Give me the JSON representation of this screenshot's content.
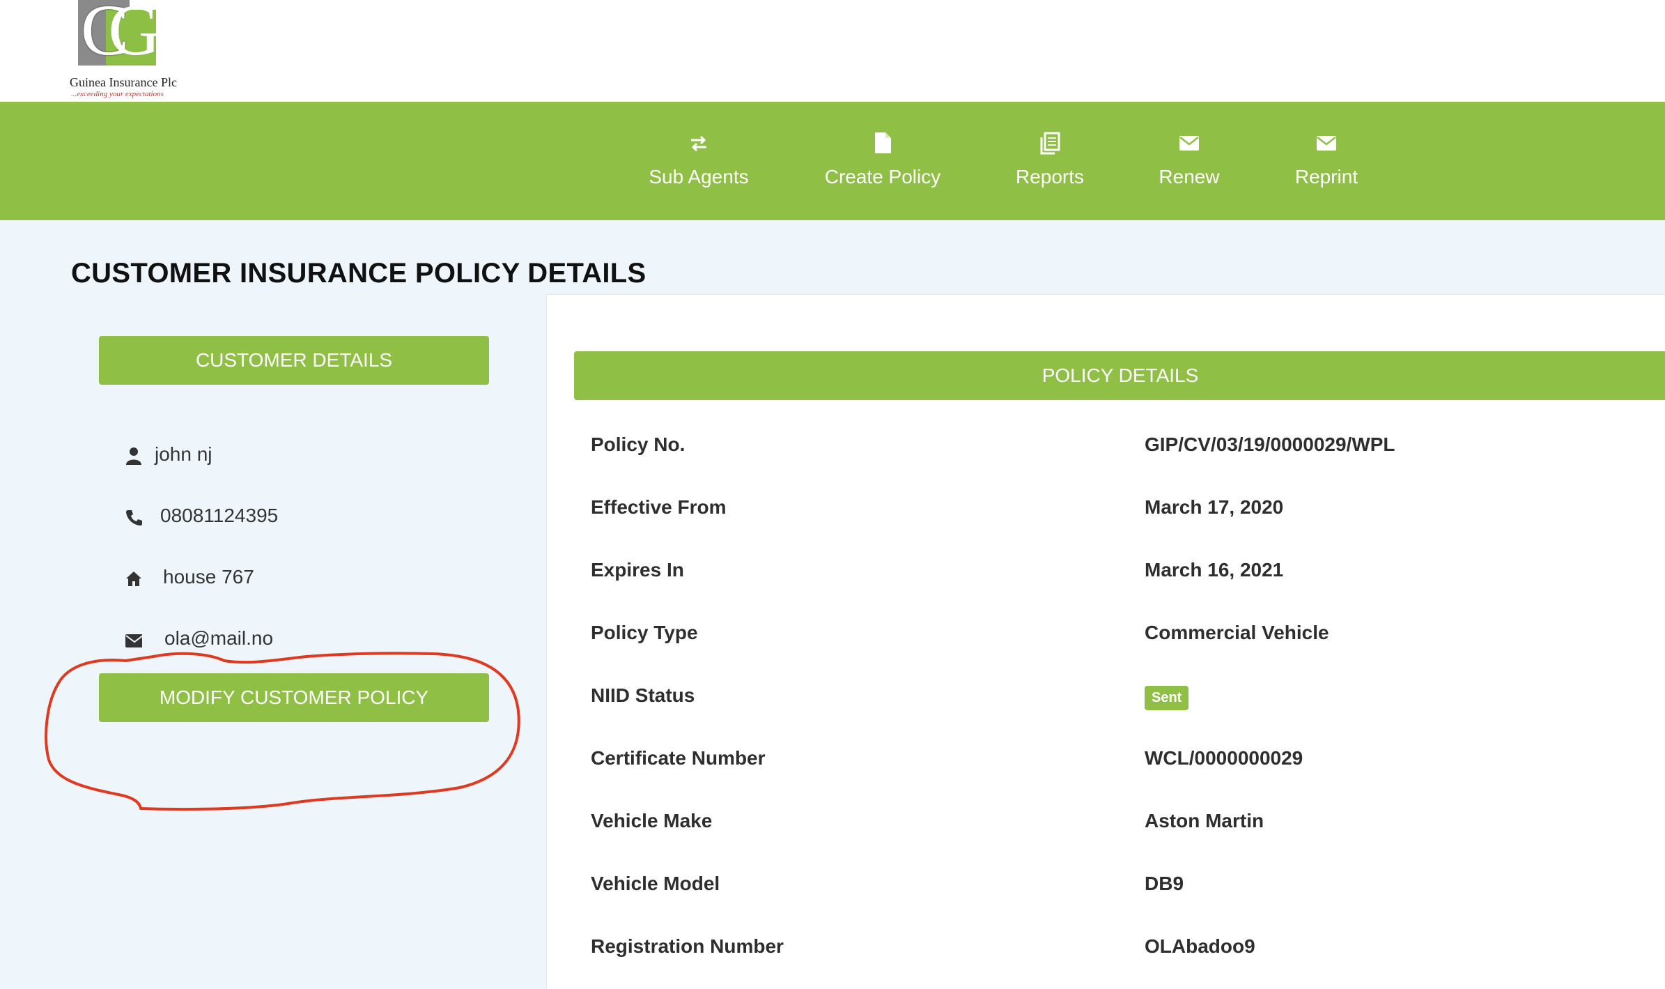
{
  "brand": {
    "name": "Guinea Insurance Plc",
    "tagline": "...exceeding your expectations",
    "logo_letters": "G"
  },
  "nav": [
    {
      "label": "Sub Agents",
      "icon": "swap-arrows-icon"
    },
    {
      "label": "Create Policy",
      "icon": "document-icon"
    },
    {
      "label": "Reports",
      "icon": "reports-icon"
    },
    {
      "label": "Renew",
      "icon": "envelope-icon"
    },
    {
      "label": "Reprint",
      "icon": "envelope-icon"
    }
  ],
  "page_title": "CUSTOMER INSURANCE POLICY DETAILS",
  "customer": {
    "header": "CUSTOMER DETAILS",
    "name": "john nj",
    "phone": "08081124395",
    "address": "house 767",
    "email": "ola@mail.no",
    "modify_button": "MODIFY CUSTOMER POLICY"
  },
  "policy": {
    "header": "POLICY DETAILS",
    "rows": [
      {
        "label": "Policy No.",
        "value": "GIP/CV/03/19/0000029/WPL"
      },
      {
        "label": "Effective From",
        "value": "March 17, 2020"
      },
      {
        "label": "Expires In",
        "value": "March 16, 2021"
      },
      {
        "label": "Policy Type",
        "value": "Commercial Vehicle"
      },
      {
        "label": "NIID Status",
        "value": "Sent"
      },
      {
        "label": "Certificate Number",
        "value": "WCL/0000000029"
      },
      {
        "label": "Vehicle Make",
        "value": "Aston Martin"
      },
      {
        "label": "Vehicle Model",
        "value": "DB9"
      },
      {
        "label": "Registration Number",
        "value": "OLAbadoo9"
      }
    ]
  },
  "colors": {
    "brand_green": "#8fc045",
    "page_bg": "#eef6fc",
    "annotation_red": "#e0391f"
  }
}
